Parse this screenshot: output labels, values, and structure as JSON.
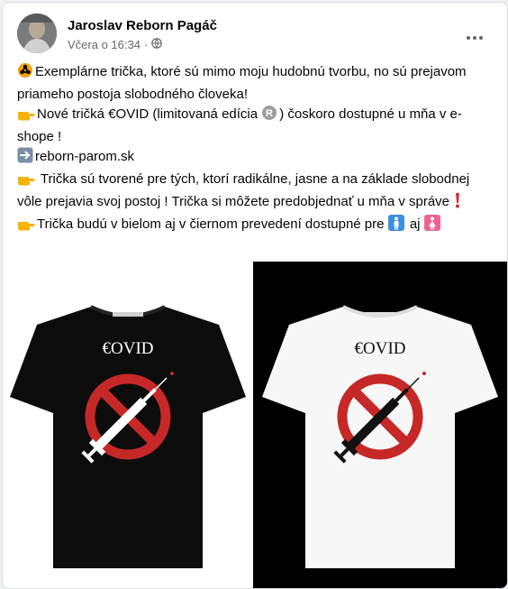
{
  "post": {
    "author": "Jaroslav Reborn Pagáč",
    "time": "Včera o 16:34",
    "separator": "·"
  },
  "body": {
    "line1": "Exemplárne trička, ktoré sú mimo moju hudobnú tvorbu, no sú prejavom priameho postoja slobodného človeka!",
    "line2a": "Nové tričká €OVID (limitovaná edícia ",
    "line2b": ") čoskoro dostupné u mňa v e-shope !",
    "line3": "reborn-parom.sk",
    "line4a": " Trička sú tvorené pre tých, ktorí radikálne, jasne a na základe slobodnej vôle prejavia svoj postoj !  Trička si môžete predobjednať u mňa v správe ",
    "line5a": "Trička budú v bielom aj v čiernom prevedení dostupné pre ",
    "line5b": " aj "
  },
  "image": {
    "shirt_text": "€OVID"
  },
  "icons": {
    "biohazard": "biohazard-icon",
    "hand": "backhand-index-pointing-right-icon",
    "arrow": "right-arrow-icon",
    "registered": "registered-icon",
    "exclamation": "red-exclamation-icon",
    "male": "male-sign-icon",
    "female": "female-sign-icon",
    "globe": "globe-icon",
    "more": "more-options-icon"
  },
  "colors": {
    "hand": "#f4b400",
    "biohazard": "#f4a300",
    "blue_box": "#3b8fe0",
    "pink_box": "#f06292",
    "red_sign": "#c62828"
  }
}
